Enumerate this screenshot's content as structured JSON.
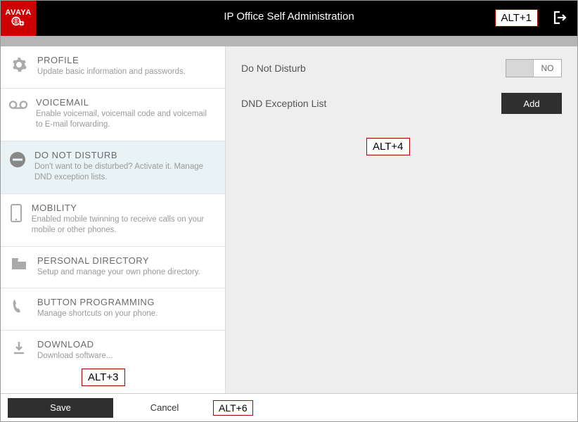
{
  "header": {
    "logo_text": "AVAYA",
    "title": "IP Office Self Administration",
    "hint1": "ALT+1"
  },
  "sidebar": {
    "items": [
      {
        "title": "PROFILE",
        "desc": "Update basic information and passwords."
      },
      {
        "title": "VOICEMAIL",
        "desc": "Enable voicemail, voicemail code and voicemail to E-mail forwarding."
      },
      {
        "title": "DO NOT DISTURB",
        "desc": "Don't want to be disturbed? Activate it. Manage DND exception lists."
      },
      {
        "title": "MOBILITY",
        "desc": "Enabled mobile twinning to receive calls on your mobile or other phones."
      },
      {
        "title": "PERSONAL DIRECTORY",
        "desc": "Setup and manage your own phone directory."
      },
      {
        "title": "BUTTON PROGRAMMING",
        "desc": "Manage shortcuts on your phone."
      },
      {
        "title": "DOWNLOAD",
        "desc": "Download software..."
      }
    ],
    "hint3": "ALT+3"
  },
  "main": {
    "dnd_label": "Do Not Disturb",
    "dnd_value": "NO",
    "exception_label": "DND Exception List",
    "add_label": "Add",
    "hint4": "ALT+4"
  },
  "footer": {
    "save": "Save",
    "cancel": "Cancel",
    "hint6": "ALT+6"
  }
}
